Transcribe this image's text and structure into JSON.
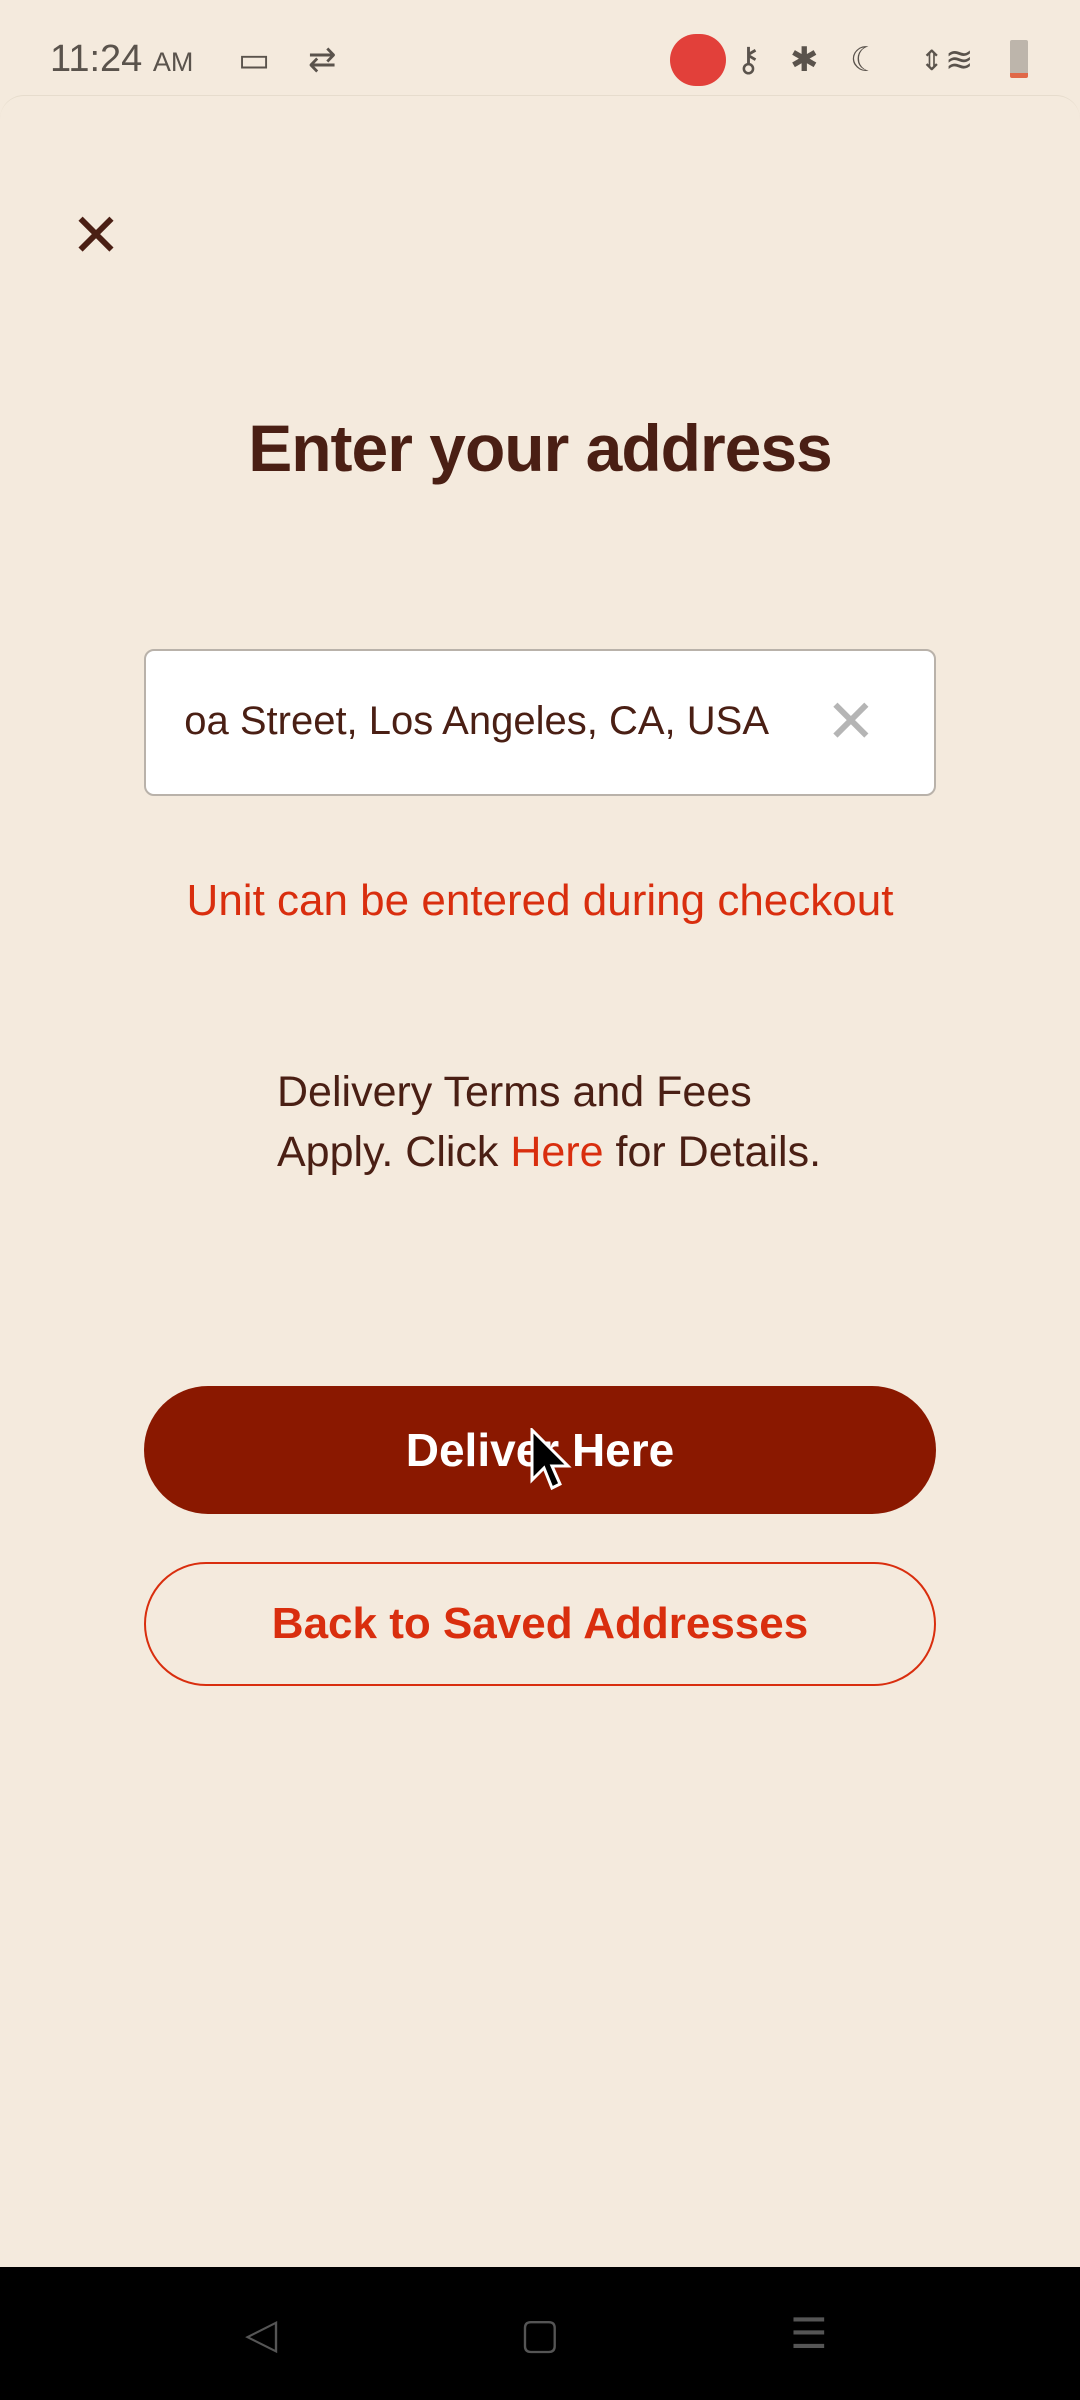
{
  "status_bar": {
    "time": "11:24",
    "ampm": "AM"
  },
  "page": {
    "title": "Enter your address",
    "address_value": "oa Street, Los Angeles, CA, USA",
    "unit_note": "Unit can be entered during checkout",
    "terms_before": "Delivery Terms and Fees Apply. Click ",
    "terms_link": "Here",
    "terms_after": " for Details.",
    "deliver_label": "Deliver Here",
    "back_label": "Back to Saved Addresses"
  },
  "colors": {
    "background": "#f4eadd",
    "primary": "#8a1800",
    "accent": "#d92e0e",
    "text": "#4a1f14"
  }
}
